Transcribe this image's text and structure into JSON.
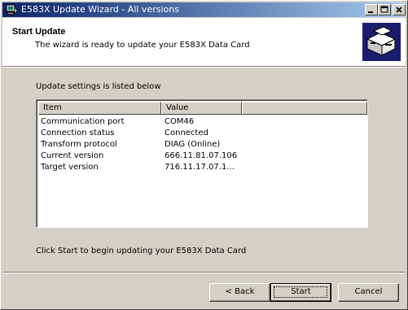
{
  "window": {
    "title": "E583X Update Wizard - All versions"
  },
  "header": {
    "title": "Start Update",
    "subtitle": "The wizard is ready to update your E583X Data Card",
    "logo_icon": "wizard-computer-icon"
  },
  "body": {
    "intro": "Update settings is listed below",
    "columns": {
      "item": "Item",
      "value": "Value"
    },
    "rows": [
      {
        "item": "Communication port",
        "value": "COM46"
      },
      {
        "item": "Connection status",
        "value": "Connected"
      },
      {
        "item": "Transform protocol",
        "value": "DIAG (Online)"
      },
      {
        "item": "Current version",
        "value": "666.11.81.07.106"
      },
      {
        "item": "Target version",
        "value": "716.11.17.07.1..."
      }
    ],
    "footer": "Click Start to begin updating your E583X Data Card"
  },
  "buttons": {
    "back": "< Back",
    "start": "Start",
    "cancel": "Cancel"
  }
}
